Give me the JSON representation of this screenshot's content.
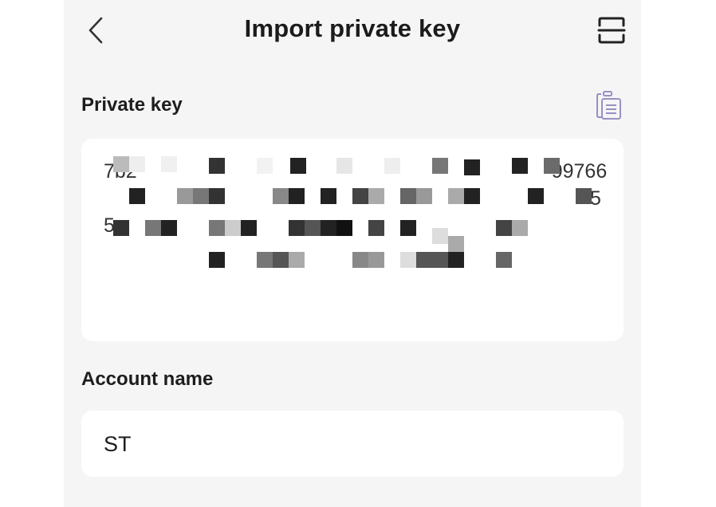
{
  "header": {
    "title": "Import private key",
    "back_icon": "chevron-left-icon",
    "scan_icon": "scan-icon"
  },
  "private_key": {
    "label": "Private key",
    "paste_icon": "clipboard-icon",
    "value_visible_fragments": [
      "7b2",
      "99766",
      "5",
      "5"
    ],
    "redacted": true
  },
  "account": {
    "label": "Account name",
    "value": "ST"
  },
  "colors": {
    "background": "#f5f5f5",
    "card": "#ffffff",
    "text": "#1d1d1d",
    "icon": "#333333",
    "paste_icon": "#9a90c4"
  }
}
